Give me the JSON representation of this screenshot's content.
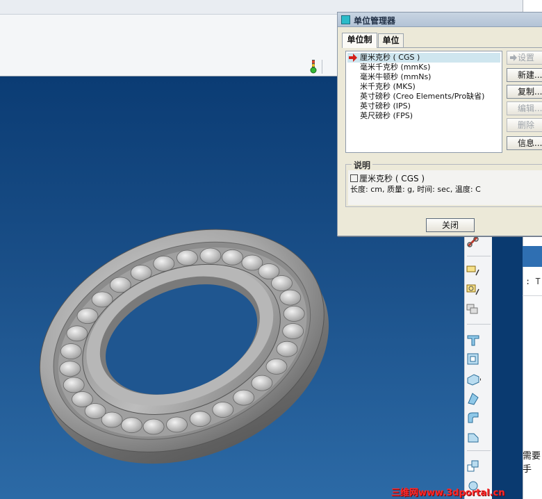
{
  "dialog": {
    "title": "单位管理器",
    "tabs": [
      {
        "label": "单位制",
        "active": true
      },
      {
        "label": "单位",
        "active": false
      }
    ],
    "unit_systems": [
      {
        "label": "厘米克秒 ( CGS )",
        "selected": true
      },
      {
        "label": "毫米千克秒 (mmKs)",
        "selected": false
      },
      {
        "label": "毫米牛顿秒 (mmNs)",
        "selected": false
      },
      {
        "label": "米千克秒 (MKS)",
        "selected": false
      },
      {
        "label": "英寸磅秒 (Creo Elements/Pro缺省)",
        "selected": false
      },
      {
        "label": "英寸磅秒 (IPS)",
        "selected": false
      },
      {
        "label": "英尺磅秒 (FPS)",
        "selected": false
      }
    ],
    "buttons": {
      "set": "设置",
      "new": "新建...",
      "copy": "复制...",
      "edit": "编辑...",
      "delete": "删除",
      "info": "信息..."
    },
    "description": {
      "label": "说明",
      "line1": "厘米克秒 ( CGS )",
      "line2": "长度: cm, 质量: g, 时间: sec, 温度: C"
    },
    "close_label": "关闭"
  },
  "right_panel": {
    "text1": ": T",
    "text2": "需要手"
  },
  "watermark": "三维网www.3dportal.cn",
  "colors": {
    "viewport_top": "#0b3c74",
    "viewport_bottom": "#2c6aa6",
    "selection": "#cfe6ef",
    "watermark": "#ff2a2a"
  }
}
